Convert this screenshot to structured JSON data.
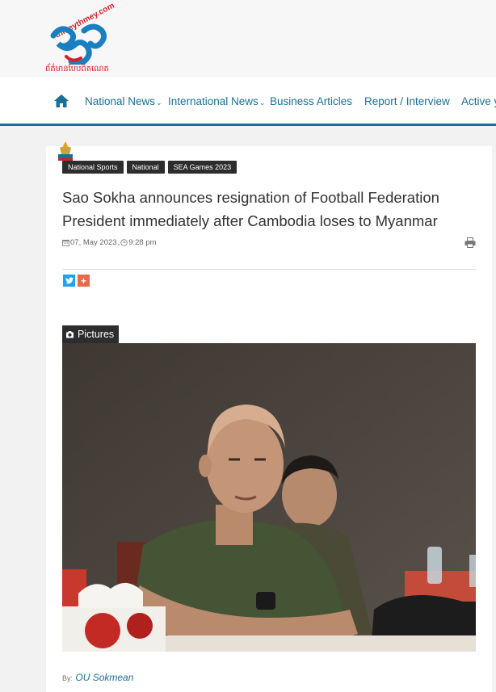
{
  "header": {
    "logo_text": "thmeythmey.com",
    "logo_tagline": "ព័ត៌មានបែបពិតណេត"
  },
  "nav": {
    "home_icon": "home-icon",
    "items": [
      {
        "label": "National News",
        "has_dropdown": true
      },
      {
        "label": "International News",
        "has_dropdown": true
      },
      {
        "label": "Business Articles",
        "has_dropdown": false
      },
      {
        "label": "Report / Interview",
        "has_dropdown": false
      },
      {
        "label": "Active y",
        "has_dropdown": false
      }
    ],
    "caret": "⌄",
    "accent_color": "#1a6f95"
  },
  "article": {
    "tags": [
      "National Sports",
      "National",
      "SEA Games 2023"
    ],
    "title": "Sao Sokha announces resignation of Football Federation President immediately after Cambodia loses to Myanmar",
    "date": "07, May 2023",
    "time": "9:28 pm",
    "share": {
      "twitter": "twitter-icon",
      "plus": "+"
    },
    "pictures_label": "Pictures",
    "byline_prefix": "By:",
    "author": "OU Sokmean"
  }
}
